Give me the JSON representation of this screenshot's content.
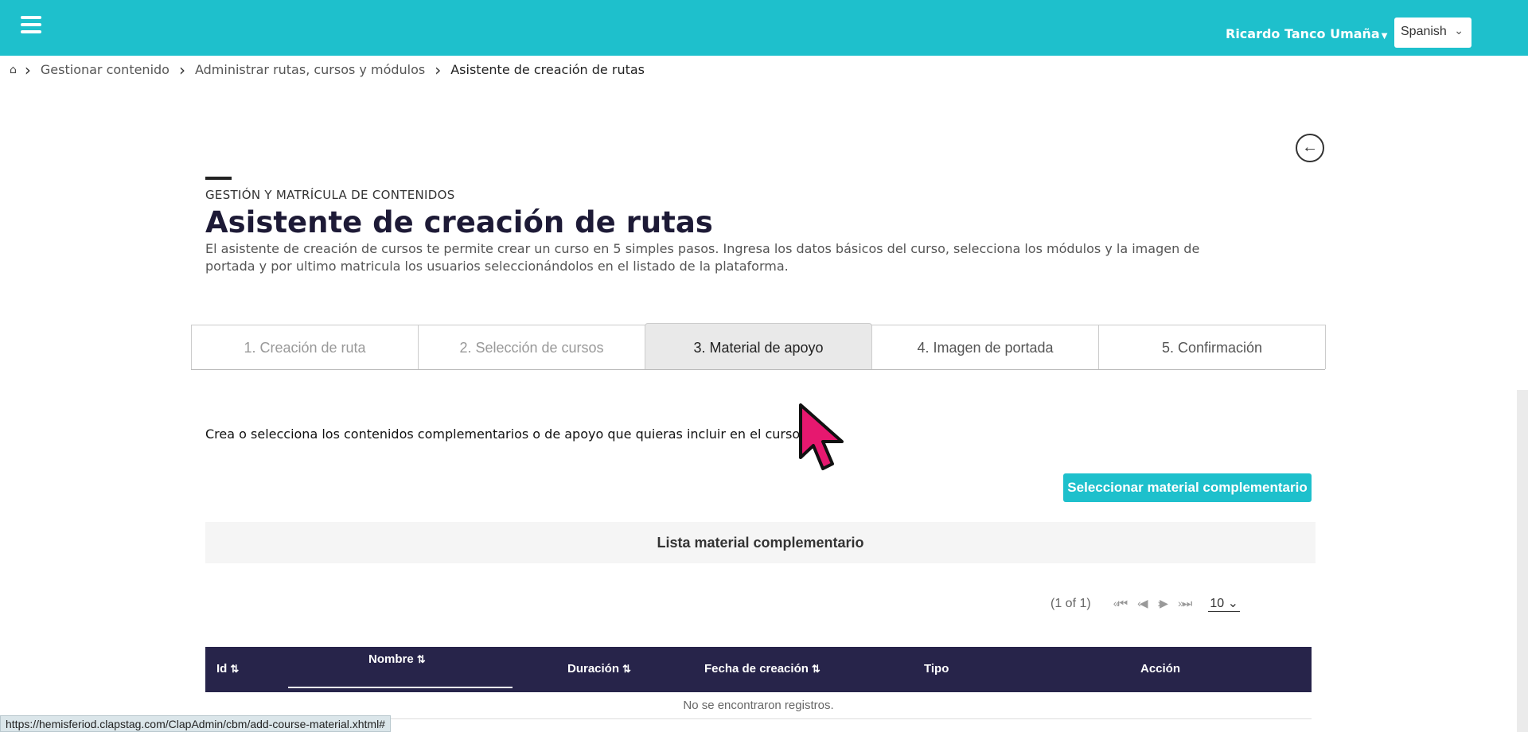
{
  "header": {
    "user_name": "Ricardo Tanco Umaña",
    "language": "Spanish"
  },
  "breadcrumb": {
    "items": [
      "Gestionar contenido",
      "Administrar rutas, cursos y módulos",
      "Asistente de creación de rutas"
    ]
  },
  "page": {
    "overline": "GESTIÓN Y MATRÍCULA DE CONTENIDOS",
    "title": "Asistente de creación de rutas",
    "description": "El asistente de creación de cursos te permite crear un curso en 5 simples pasos. Ingresa los datos básicos del curso, selecciona los módulos y la imagen de portada y por ultimo matricula los usuarios seleccionándolos en el listado de la plataforma."
  },
  "tabs": [
    {
      "label": "1. Creación de ruta"
    },
    {
      "label": "2. Selección de cursos"
    },
    {
      "label": "3. Material de apoyo"
    },
    {
      "label": "4. Imagen de portada"
    },
    {
      "label": "5. Confirmación"
    }
  ],
  "step": {
    "instructions": "Crea o selecciona los contenidos complementarios o de apoyo que quieras incluir en el curso.",
    "select_button": "Seleccionar material complementario",
    "list_title": "Lista material complementario"
  },
  "paginator": {
    "count": "(1 of 1)",
    "rows_per_page": "10"
  },
  "table": {
    "columns": [
      "Id",
      "Nombre",
      "Duración",
      "Fecha de creación",
      "Tipo",
      "Acción"
    ],
    "empty_message": "No se encontraron registros."
  },
  "status_bar": {
    "url": "https://hemisferiod.clapstag.com/ClapAdmin/cbm/add-course-material.xhtml#"
  },
  "colors": {
    "accent": "#1ec0cc",
    "table_header": "#27244a",
    "cursor": "#e6186f"
  }
}
